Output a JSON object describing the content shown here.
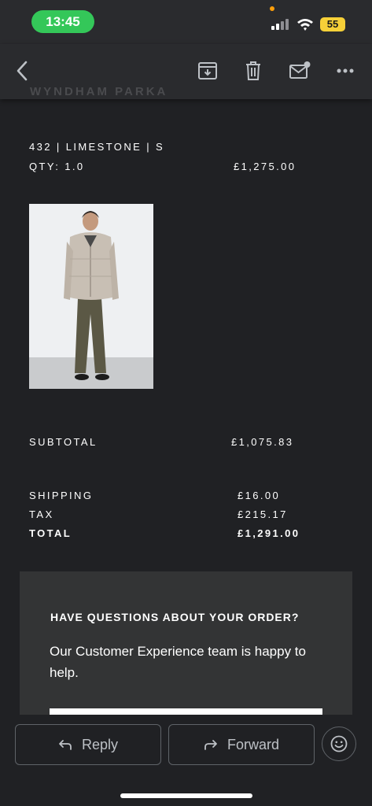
{
  "status_bar": {
    "time": "13:45",
    "battery": "55"
  },
  "header": {
    "ghost_title": "WYNDHAM PARKA"
  },
  "item": {
    "variant": "432 | LIMESTONE | S",
    "qty": "QTY: 1.0",
    "price": "£1,275.00",
    "image": "product-photo"
  },
  "summary": {
    "subtotal_label": "SUBTOTAL",
    "subtotal_value": "£1,075.83",
    "shipping_label": "SHIPPING",
    "shipping_value": "£16.00",
    "tax_label": "TAX",
    "tax_value": "£215.17",
    "total_label": "TOTAL",
    "total_value": "£1,291.00"
  },
  "questions": {
    "title": "HAVE QUESTIONS ABOUT YOUR ORDER?",
    "body": "Our Customer Experience team is happy to help."
  },
  "actions": {
    "reply": "Reply",
    "forward": "Forward"
  },
  "icons": [
    "back-icon",
    "archive-icon",
    "delete-icon",
    "mark-unread-icon",
    "more-icon",
    "reply-icon",
    "forward-icon",
    "emoji-icon"
  ],
  "colors": {
    "background": "#202124",
    "toolbar": "#2a2b2e",
    "accent_green": "#34c759",
    "battery": "#f7d038"
  }
}
